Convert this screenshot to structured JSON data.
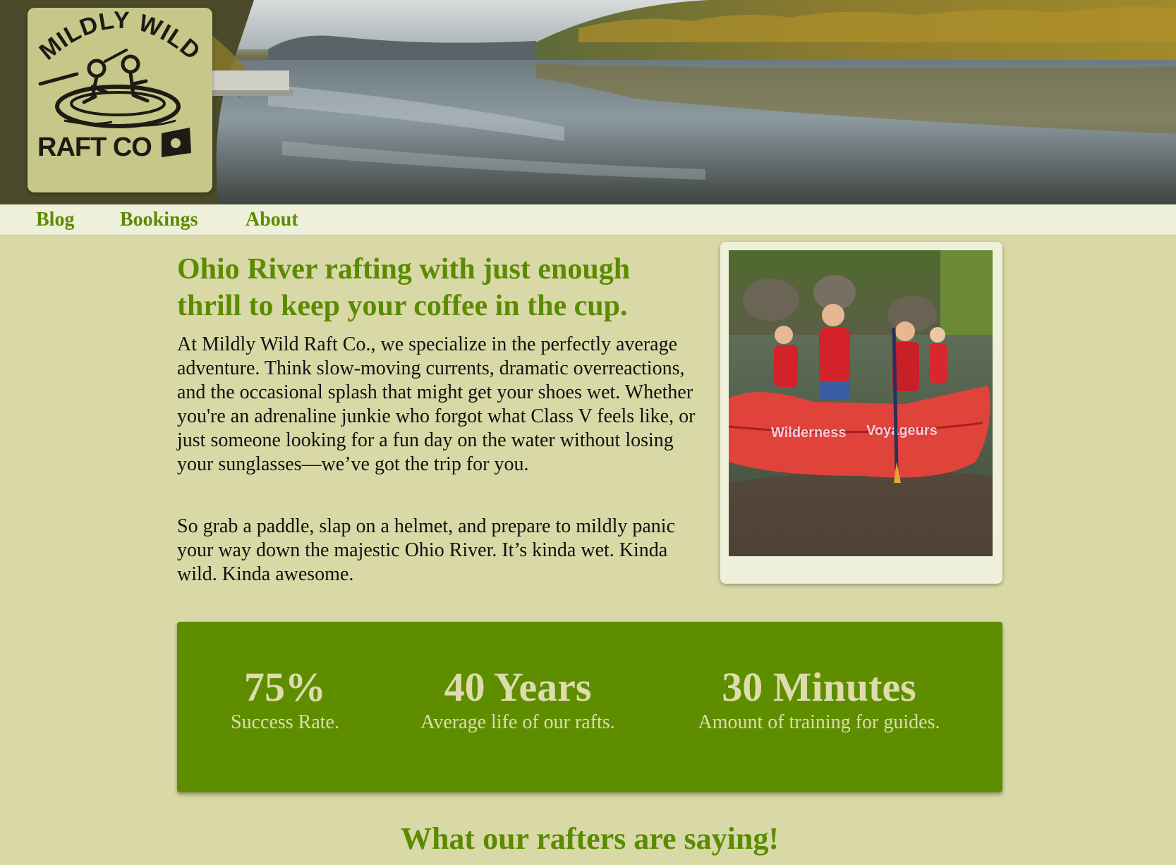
{
  "brand": {
    "logo_text_top": "MILDLY WILD",
    "logo_text_bottom": "RAFT CO"
  },
  "nav": {
    "items": [
      {
        "label": "Blog"
      },
      {
        "label": "Bookings"
      },
      {
        "label": "About"
      }
    ]
  },
  "intro": {
    "headline": "Ohio River rafting with just enough thrill to keep your coffee in the cup.",
    "paragraph1": "At Mildly Wild Raft Co., we specialize in the perfectly average adventure. Think slow-moving currents, dramatic overreactions, and the occasional splash that might get your shoes wet. Whether you're an adrenaline junkie who forgot what Class V feels like, or just someone looking for a fun day on the water without losing your sunglasses—we’ve got the trip for you.",
    "paragraph2": "So grab a paddle, slap on a helmet, and prepare to mildly panic your way down the majestic Ohio River. It’s kinda wet. Kinda wild. Kinda awesome."
  },
  "photo": {
    "raft_text_left": "Wilderness",
    "raft_text_right": "Voyageurs"
  },
  "stats": [
    {
      "value": "75%",
      "label": "Success Rate."
    },
    {
      "value": "40 Years",
      "label": "Average life of our rafts."
    },
    {
      "value": "30 Minutes",
      "label": "Amount of training for guides."
    }
  ],
  "testimonials": {
    "title": "What our rafters are saying!"
  },
  "colors": {
    "page_bg": "#d9d9a7",
    "accent_green": "#5b8b00",
    "stats_bg": "#5e8e00",
    "stats_text": "#dedcac",
    "nav_bg": "#eff0da",
    "logo_bg": "#c7c78a"
  }
}
